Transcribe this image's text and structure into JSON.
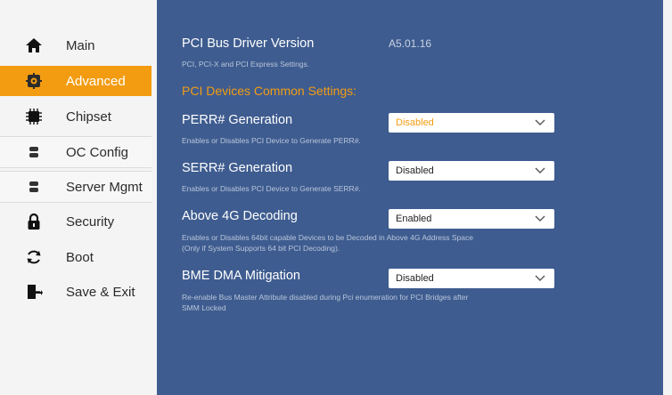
{
  "sidebar": {
    "items": [
      {
        "label": "Main",
        "icon": "home-icon"
      },
      {
        "label": "Advanced",
        "icon": "settings-gear-icon"
      },
      {
        "label": "Chipset",
        "icon": "chip-icon"
      },
      {
        "label": "OC Config",
        "icon": "server-icon"
      },
      {
        "label": "Server Mgmt",
        "icon": "server-icon"
      },
      {
        "label": "Security",
        "icon": "lock-icon"
      },
      {
        "label": "Boot",
        "icon": "refresh-icon"
      },
      {
        "label": "Save & Exit",
        "icon": "exit-door-icon"
      }
    ],
    "active": "Advanced"
  },
  "content": {
    "driver_label": "PCI Bus Driver Version",
    "driver_value": "A5.01.16",
    "driver_desc": "PCI, PCI-X and PCI Express Settings.",
    "section_title": "PCI Devices Common Settings:",
    "settings": [
      {
        "label": "PERR# Generation",
        "value": "Disabled",
        "desc": "Enables or Disables PCI Device to Generate PERR#."
      },
      {
        "label": "SERR# Generation",
        "value": "Disabled",
        "desc": "Enables or Disables PCI Device to Generate SERR#."
      },
      {
        "label": "Above 4G Decoding",
        "value": "Enabled",
        "desc": "Enables or Disables 64bit capable Devices to be Decoded in Above 4G Address Space",
        "desc2": "(Only if System Supports 64 bit PCI Decoding)."
      },
      {
        "label": "BME DMA Mitigation",
        "value": "Disabled",
        "desc": "Re-enable Bus Master Attribute disabled during Pci enumeration for PCI Bridges after",
        "desc2": "SMM Locked"
      }
    ]
  },
  "colors": {
    "accent": "#f39c12",
    "panel": "#3e5c8f",
    "sidebar": "#f4f4f4"
  }
}
